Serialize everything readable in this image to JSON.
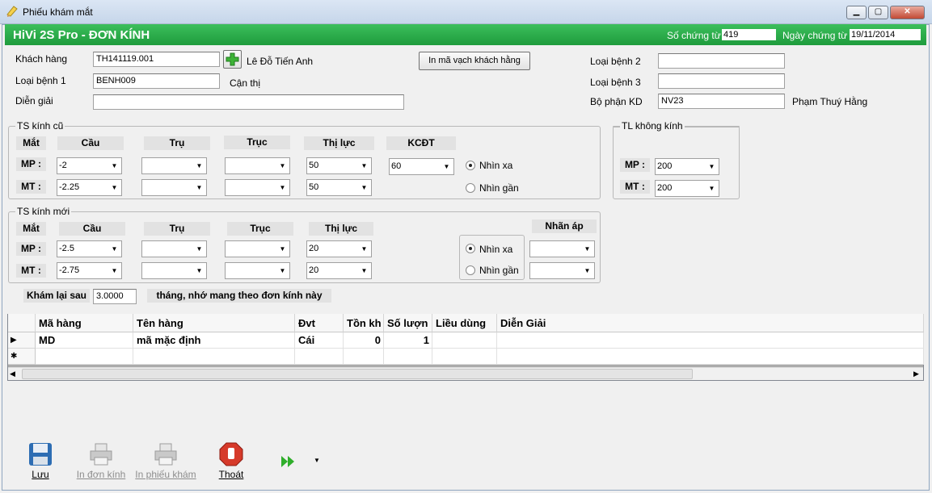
{
  "window": {
    "title": "Phiếu khám mắt",
    "min": "▁",
    "max": "▢",
    "close": "✕"
  },
  "banner": {
    "title": "HiVi 2S Pro - ĐƠN KÍNH",
    "so_chung_tu_label": "Số chứng từ",
    "so_chung_tu_value": "419",
    "ngay_chung_tu_label": "Ngày chứng từ",
    "ngay_chung_tu_value": "19/11/2014"
  },
  "form": {
    "khach_hang_label": "Khách hàng",
    "khach_hang_value": "TH141119.001",
    "khach_hang_name": "Lê Đỗ Tiến Anh",
    "loai_benh1_label": "Loại bệnh 1",
    "loai_benh1_value": "BENH009",
    "loai_benh1_name": "Cận thị",
    "dien_giai_label": "Diễn giải",
    "dien_giai_value": "",
    "print_barcode_button": "In mã vạch khách hằng",
    "loai_benh2_label": "Loại bệnh 2",
    "loai_benh2_value": "",
    "loai_benh3_label": "Loại bệnh 3",
    "loai_benh3_value": "",
    "bo_phan_label": "Bộ phận KD",
    "bo_phan_value": "NV23",
    "bo_phan_name": "Phạm Thuý Hằng"
  },
  "old_lens": {
    "title": "TS kính cũ",
    "headers": {
      "mat": "Mắt",
      "cau": "Cầu",
      "tru": "Trụ",
      "truc": "Trục",
      "thiluc": "Thị lực",
      "kcdt": "KCĐT"
    },
    "mp_label": "MP :",
    "mt_label": "MT :",
    "mp": {
      "cau": "-2",
      "tru": "",
      "truc": "",
      "thiluc": "50",
      "kcdt": "60"
    },
    "mt": {
      "cau": "-2.25",
      "tru": "",
      "truc": "",
      "thiluc": "50"
    },
    "nhin_xa": "Nhìn xa",
    "nhin_gan": "Nhìn gần"
  },
  "no_lens": {
    "title": "TL không kính",
    "mp_label": "MP :",
    "mp_value": "200",
    "mt_label": "MT :",
    "mt_value": "200"
  },
  "new_lens": {
    "title": "TS kính mới",
    "headers": {
      "mat": "Mắt",
      "cau": "Cầu",
      "tru": "Trụ",
      "truc": "Trục",
      "thiluc": "Thị lực",
      "nhanap": "Nhãn áp"
    },
    "mp_label": "MP :",
    "mt_label": "MT :",
    "mp": {
      "cau": "-2.5",
      "tru": "",
      "truc": "",
      "thiluc": "20",
      "nhanap": ""
    },
    "mt": {
      "cau": "-2.75",
      "tru": "",
      "truc": "",
      "thiluc": "20",
      "nhanap": ""
    },
    "nhin_xa": "Nhìn xa",
    "nhin_gan": "Nhìn gần"
  },
  "recheck": {
    "label": "Khám lại sau",
    "value": "3.0000",
    "note": "tháng, nhớ mang theo đơn kính này"
  },
  "grid": {
    "columns": [
      "Mã hàng",
      "Tên hàng",
      "Đvt",
      "Tồn kh",
      "Số lượn",
      "Liều dùng",
      "Diễn Giải"
    ],
    "rows": [
      {
        "ma": "MD",
        "ten": "mã mặc định",
        "dvt": "Cái",
        "ton": "0",
        "sl": "1",
        "lieu": "",
        "dg": ""
      }
    ],
    "current_marker": "▶",
    "new_marker": "✱"
  },
  "toolbar": {
    "save": "Lưu",
    "print_lens": "In đơn kính",
    "print_exam": "In phiếu khám",
    "exit": "Thoát"
  }
}
